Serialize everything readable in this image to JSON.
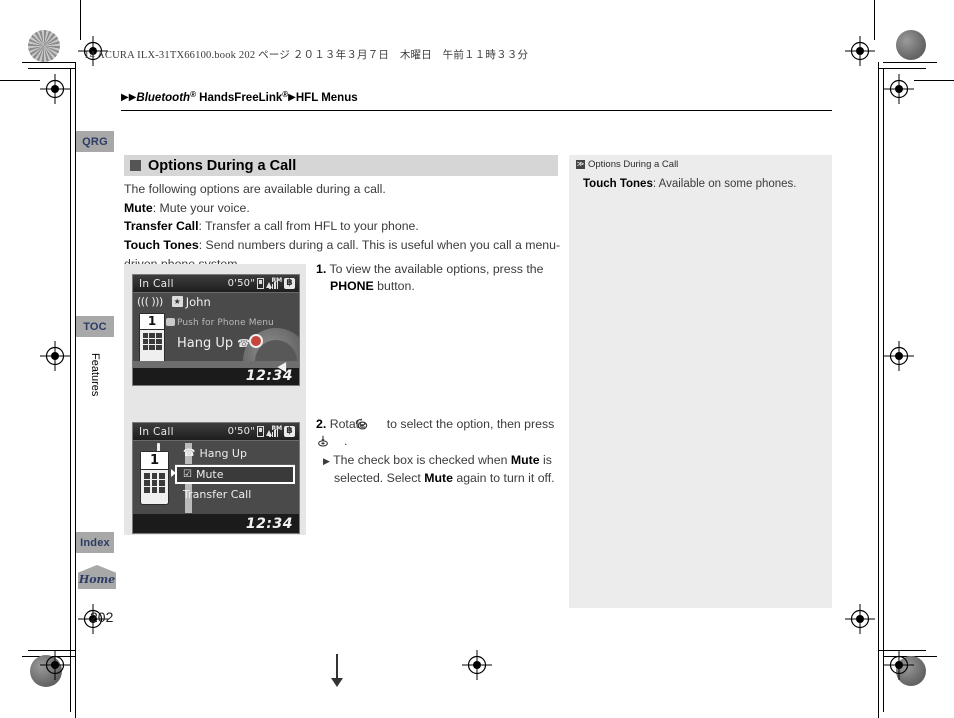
{
  "print": {
    "book_info": "14 ACURA ILX-31TX66100.book  202 ページ  ２０１３年３月７日　木曜日　午前１１時３３分"
  },
  "breadcrumb": {
    "tri1": "▶",
    "tri2": "▶",
    "part1": "Bluetooth",
    "sup1": "®",
    "part2": " HandsFreeLink",
    "sup2": "®",
    "tri3": "▶",
    "part3": "HFL Menus"
  },
  "tabs": {
    "qrg": "QRG",
    "toc": "TOC",
    "features": "Features",
    "index": "Index",
    "home": "Home"
  },
  "page_number": "202",
  "section": {
    "title": "Options During a Call",
    "intro": "The following options are available during a call.",
    "items": [
      {
        "term": "Mute",
        "desc": ": Mute your voice."
      },
      {
        "term": "Transfer Call",
        "desc": ": Transfer a call from HFL to your phone."
      },
      {
        "term": "Touch Tones",
        "desc": ": Send numbers during a call. This is useful when you call a menu-driven phone system."
      }
    ]
  },
  "figure": {
    "screen1": {
      "status_left": "In Call",
      "duration": "0'50\"",
      "roaming": "RM",
      "bluetooth_icon": "bluetooth-icon",
      "ring_indicator": "((( )))",
      "contact_icon": "contact-icon",
      "caller_name": "John",
      "keypad_number": "1",
      "push_hint": "Push for Phone Menu",
      "hang_up": "Hang Up",
      "clock": "12:34"
    },
    "screen2": {
      "status_left": "In Call",
      "duration": "0'50\"",
      "roaming": "RM",
      "phone_number": "1",
      "menu": [
        {
          "label": "Hang Up",
          "icon": "handset-icon",
          "selected": false
        },
        {
          "label": "Mute",
          "icon": "checkbox-checked-icon",
          "selected": true
        },
        {
          "label": "Transfer Call",
          "icon": "",
          "selected": false
        }
      ],
      "clock": "12:34"
    },
    "flow_arrow": "arrow-down-icon"
  },
  "steps": [
    {
      "number": "1.",
      "text_a": "To view the available options, press the ",
      "bold": "PHONE",
      "text_b": " button."
    },
    {
      "number": "2.",
      "text_a": "Rotate ",
      "icon_rotate": "rotate-knob-icon",
      "text_b": " to select the option, then press ",
      "icon_press": "press-knob-icon",
      "text_c": ".",
      "sub_tri": "▶",
      "sub_a": "The check box is checked when ",
      "sub_b1": "Mute",
      "sub_c": " is selected. Select ",
      "sub_b2": "Mute",
      "sub_d": " again to turn it off."
    }
  ],
  "note": {
    "marker": "≫",
    "title": "Options During a Call",
    "term": "Touch Tones",
    "text": ": Available on some phones."
  },
  "colors": {
    "tab_bg": "#a8a8a8",
    "tab_text": "#2c3c66",
    "section_bg": "#d6d6d6",
    "note_bg": "#ececec",
    "lcd_bg": "#4a4a4a"
  }
}
